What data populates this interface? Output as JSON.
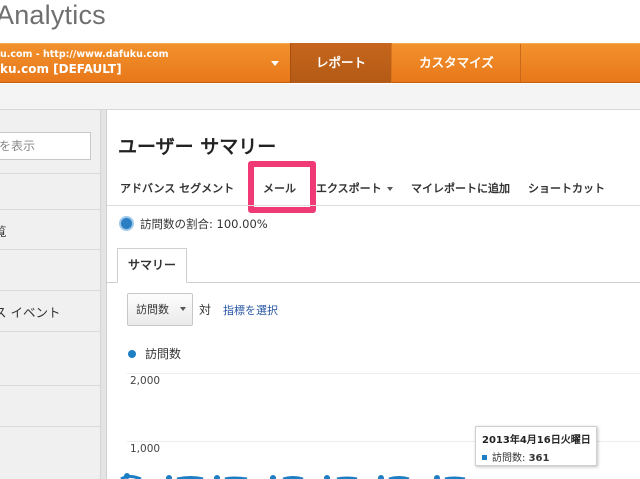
{
  "brand": {
    "title": "Analytics"
  },
  "nav": {
    "account_url": "u.com - http://www.dafuku.com",
    "account_name": "ku.com [DEFAULT]",
    "tabs": [
      {
        "label": "レポート",
        "active": true
      },
      {
        "label": "カスタマイズ",
        "active": false
      }
    ]
  },
  "sidebar": {
    "search_placeholder": "を表示",
    "items": [
      {
        "label": "覧"
      },
      {
        "label": "ス イベント"
      }
    ]
  },
  "main": {
    "title": "ユーザー サマリー",
    "toolbar": {
      "advanced_segments": "アドバンス セグメント",
      "email": "メール",
      "export": "エクスポート",
      "add_to_dashboard": "マイレポートに追加",
      "shortcut": "ショートカット"
    },
    "segment_text": "訪問数の割合: 100.00%",
    "tabs": [
      {
        "label": "サマリー"
      }
    ],
    "metric_select": {
      "value": "訪問数"
    },
    "vs_label": "対",
    "select_metric_link": "指標を選択",
    "legend_label": "訪問数"
  },
  "chart_data": {
    "type": "line",
    "ytick_labels": [
      "2,000",
      "1,000"
    ],
    "series": [
      {
        "name": "訪問数",
        "values": [
          361
        ]
      }
    ],
    "x": [
      "2013年4月16日火曜日"
    ],
    "tooltip": {
      "date": "2013年4月16日火曜日",
      "metric": "訪問数",
      "value": "361"
    }
  },
  "colors": {
    "nav_orange": "#ee8423",
    "highlight": "#f03a76",
    "series_blue": "#1e7ec4",
    "link_blue": "#2755a3"
  }
}
